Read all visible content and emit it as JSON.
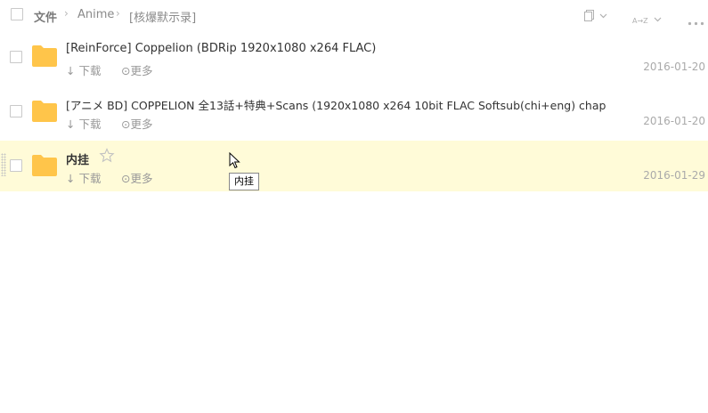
{
  "header": {
    "crumbs": [
      "文件",
      "Anime",
      "[核爆默示录]"
    ],
    "icons": [
      "copy-icon",
      "sort-icon",
      "more-icon"
    ],
    "sort_label": "A→Z"
  },
  "rows": [
    {
      "name": "[ReinForce] Coppelion (BDRip 1920x1080 x264 FLAC)",
      "download": "下载",
      "more": "更多",
      "date": "2016-01-20"
    },
    {
      "name": "[アニメ BD] COPPELION 全13話+特典+Scans (1920x1080 x264 10bit FLAC Softsub(chi+eng) chap",
      "download": "下载",
      "more": "更多",
      "date": "2016-01-20"
    },
    {
      "name": "内挂",
      "download": "下载",
      "more": "更多",
      "date": "2016-01-29",
      "hovered": true
    }
  ],
  "tooltip": "内挂",
  "colors": {
    "hover_row": "#fffbd8",
    "folder": "#ffc54a",
    "muted_text": "#999999"
  }
}
